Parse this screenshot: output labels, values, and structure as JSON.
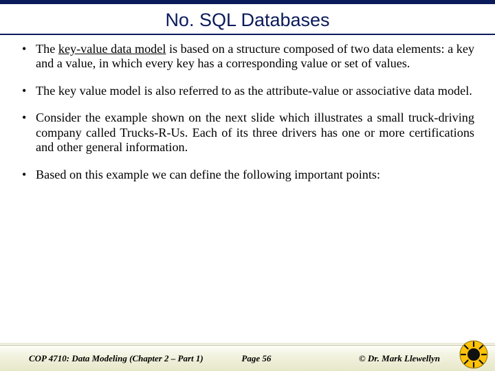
{
  "title": "No. SQL Databases",
  "bullets": [
    {
      "pre": "The ",
      "under": "key-value data model",
      "post": " is based on a structure composed of two data elements: a key and a value, in which every key has a corresponding value or set of values."
    },
    {
      "text": "The key value model is also referred to as the attribute-value or associative data model."
    },
    {
      "text": "Consider the example shown on the next slide which illustrates a small truck-driving company called Trucks-R-Us.  Each of its three drivers has one or more certifications and other general information."
    },
    {
      "text": "Based on this example we can define the following important points:"
    }
  ],
  "footer": {
    "left": "COP 4710: Data Modeling (Chapter 2 – Part 1)",
    "center": "Page 56",
    "right": "© Dr. Mark Llewellyn"
  }
}
